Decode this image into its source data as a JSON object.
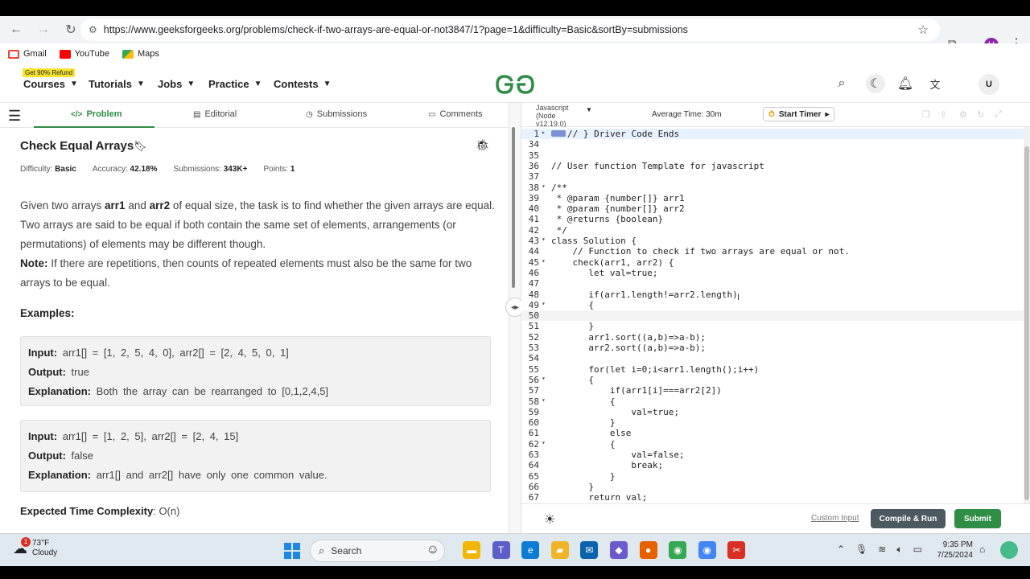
{
  "browser": {
    "url": "https://www.geeksforgeeks.org/problems/check-if-two-arrays-are-equal-or-not3847/1?page=1&difficulty=Basic&sortBy=submissions",
    "profile_initial": "U",
    "bookmarks": [
      {
        "label": "Gmail",
        "color": "#ea4335"
      },
      {
        "label": "YouTube",
        "color": "#ff0000"
      },
      {
        "label": "Maps",
        "color": "#34a853"
      }
    ]
  },
  "site_header": {
    "refund_badge": "Get 90% Refund",
    "nav": [
      "Courses",
      "Tutorials",
      "Jobs",
      "Practice",
      "Contests"
    ],
    "logo_text": "GG",
    "user_initial": "U"
  },
  "tabs": [
    "Problem",
    "Editorial",
    "Submissions",
    "Comments"
  ],
  "problem": {
    "title": "Check Equal Arrays",
    "meta": [
      {
        "label": "Difficulty:",
        "value": "Basic"
      },
      {
        "label": "Accuracy:",
        "value": "42.18%"
      },
      {
        "label": "Submissions:",
        "value": "343K+"
      },
      {
        "label": "Points:",
        "value": "1"
      }
    ],
    "desc": {
      "p1a": "Given two arrays ",
      "b1": "arr1",
      "p1b": " and ",
      "b2": "arr2",
      "p1c": " of equal size, the task is to find whether the given arrays are equal. Two arrays are said to be equal if both contain the same set of elements, arrangements (or permutations) of elements may be different though.",
      "note_label": "Note:",
      "note_text": " If there are repetitions, then counts of repeated elements must also be the same for two arrays to be equal."
    },
    "examples_heading": "Examples:",
    "examples": [
      {
        "input_label": "Input:",
        "input": "arr1[] = [1, 2, 5, 4, 0], arr2[] = [2, 4, 5, 0, 1]",
        "output_label": "Output:",
        "output": "true",
        "expl_label": "Explanation:",
        "explanation": "Both the array can be rearranged to [0,1,2,4,5]"
      },
      {
        "input_label": "Input:",
        "input": "arr1[] = [1, 2, 5], arr2[] = [2, 4, 15]",
        "output_label": "Output:",
        "output": "false",
        "expl_label": "Explanation:",
        "explanation": "arr1[] and arr2[] have only one common value."
      }
    ],
    "complexity_label": "Expected Time Complexity",
    "complexity_value": ": O(n)"
  },
  "editor": {
    "language": "Javascript (Node v12.19.0)",
    "avg_time": "Average Time: 30m",
    "start_timer": "Start Timer",
    "lines": [
      {
        "n": "1",
        "code": "// } Driver Code Ends",
        "cls": "c-cm",
        "fold": "▸",
        "hl": "hl-line"
      },
      {
        "n": "34",
        "code": "",
        "cls": "",
        "fold": "",
        "hl": ""
      },
      {
        "n": "35",
        "code": "",
        "cls": "",
        "fold": "",
        "hl": ""
      },
      {
        "n": "36",
        "code": "// User function Template for javascript",
        "cls": "c-cm",
        "fold": "",
        "hl": ""
      },
      {
        "n": "37",
        "code": "",
        "cls": "",
        "fold": "",
        "hl": ""
      },
      {
        "n": "38",
        "code": "/**",
        "cls": "c-cm",
        "fold": "▾",
        "hl": ""
      },
      {
        "n": "39",
        "code": " * @param {number[]} arr1",
        "cls": "c-cm",
        "fold": "",
        "hl": ""
      },
      {
        "n": "40",
        "code": " * @param {number[]} arr2",
        "cls": "c-cm",
        "fold": "",
        "hl": ""
      },
      {
        "n": "41",
        "code": " * @returns {boolean}",
        "cls": "c-cm",
        "fold": "",
        "hl": ""
      },
      {
        "n": "42",
        "code": " */",
        "cls": "c-cm",
        "fold": "",
        "hl": ""
      },
      {
        "n": "43",
        "code": "class Solution {",
        "cls": "",
        "fold": "▾",
        "hl": ""
      },
      {
        "n": "44",
        "code": "    // Function to check if two arrays are equal or not.",
        "cls": "c-cm",
        "fold": "",
        "hl": ""
      },
      {
        "n": "45",
        "code": "    check(arr1, arr2) {",
        "cls": "",
        "fold": "▾",
        "hl": ""
      },
      {
        "n": "46",
        "code": "       let val=true;",
        "cls": "",
        "fold": "",
        "hl": ""
      },
      {
        "n": "47",
        "code": "",
        "cls": "",
        "fold": "",
        "hl": ""
      },
      {
        "n": "48",
        "code": "       if(arr1.length!=arr2.length)",
        "cls": "",
        "fold": "",
        "hl": ""
      },
      {
        "n": "49",
        "code": "       {",
        "cls": "",
        "fold": "▾",
        "hl": ""
      },
      {
        "n": "50",
        "code": "",
        "cls": "",
        "fold": "",
        "hl": "cur-line"
      },
      {
        "n": "51",
        "code": "       }",
        "cls": "",
        "fold": "",
        "hl": ""
      },
      {
        "n": "52",
        "code": "       arr1.sort((a,b)=>a-b);",
        "cls": "",
        "fold": "",
        "hl": ""
      },
      {
        "n": "53",
        "code": "       arr2.sort((a,b)=>a-b);",
        "cls": "",
        "fold": "",
        "hl": ""
      },
      {
        "n": "54",
        "code": "",
        "cls": "",
        "fold": "",
        "hl": ""
      },
      {
        "n": "55",
        "code": "       for(let i=0;i<arr1.length();i++)",
        "cls": "",
        "fold": "",
        "hl": ""
      },
      {
        "n": "56",
        "code": "       {",
        "cls": "",
        "fold": "▾",
        "hl": ""
      },
      {
        "n": "57",
        "code": "           if(arr1[i]===arr2[2])",
        "cls": "",
        "fold": "",
        "hl": ""
      },
      {
        "n": "58",
        "code": "           {",
        "cls": "",
        "fold": "▾",
        "hl": ""
      },
      {
        "n": "59",
        "code": "               val=true;",
        "cls": "",
        "fold": "",
        "hl": ""
      },
      {
        "n": "60",
        "code": "           }",
        "cls": "",
        "fold": "",
        "hl": ""
      },
      {
        "n": "61",
        "code": "           else",
        "cls": "",
        "fold": "",
        "hl": ""
      },
      {
        "n": "62",
        "code": "           {",
        "cls": "",
        "fold": "▾",
        "hl": ""
      },
      {
        "n": "63",
        "code": "               val=false;",
        "cls": "",
        "fold": "",
        "hl": ""
      },
      {
        "n": "64",
        "code": "               break;",
        "cls": "",
        "fold": "",
        "hl": ""
      },
      {
        "n": "65",
        "code": "           }",
        "cls": "",
        "fold": "",
        "hl": ""
      },
      {
        "n": "66",
        "code": "       }",
        "cls": "",
        "fold": "",
        "hl": ""
      },
      {
        "n": "67",
        "code": "       return val;",
        "cls": "",
        "fold": "",
        "hl": ""
      }
    ],
    "custom_input": "Custom Input",
    "compile_run": "Compile & Run",
    "submit": "Submit"
  },
  "taskbar": {
    "weather_temp": "73°F",
    "weather_desc": "Cloudy",
    "weather_badge": "1",
    "search_placeholder": "Search",
    "apps": [
      {
        "name": "file-explorer-app",
        "color": "#f2b705",
        "glyph": "▬"
      },
      {
        "name": "teams-app",
        "color": "#5b5fc7",
        "glyph": "T"
      },
      {
        "name": "edge-app",
        "color": "#0c7bd4",
        "glyph": "e"
      },
      {
        "name": "folder-app",
        "color": "#f0b429",
        "glyph": "▰"
      },
      {
        "name": "mail-app",
        "color": "#0a64ad",
        "glyph": "✉"
      },
      {
        "name": "copilot-app",
        "color": "#6a5acd",
        "glyph": "◆"
      },
      {
        "name": "firefox-app",
        "color": "#e66000",
        "glyph": "●"
      },
      {
        "name": "chrome-app",
        "color": "#34a853",
        "glyph": "◉"
      },
      {
        "name": "chrome-profile-app",
        "color": "#4285f4",
        "glyph": "◉"
      },
      {
        "name": "snipping-tool-app",
        "color": "#d93025",
        "glyph": "✂"
      }
    ],
    "time": "9:35 PM",
    "date": "7/25/2024"
  }
}
